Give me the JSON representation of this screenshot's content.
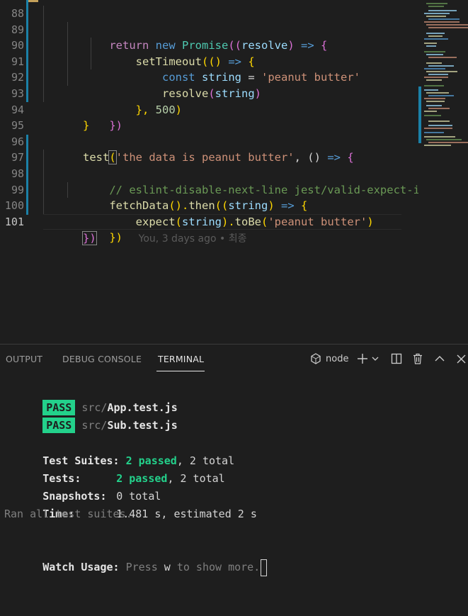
{
  "editor": {
    "line_numbers": [
      "88",
      "89",
      "90",
      "91",
      "92",
      "93",
      "94",
      "95",
      "96",
      "97",
      "98",
      "99",
      "100",
      "101"
    ],
    "lines": {
      "l88": {
        "kw": "return",
        "new": "new",
        "cls": "Promise",
        "p1": "((",
        "param": "resolve",
        "p2": ")",
        "arrow": " => ",
        "brace": "{"
      },
      "l89": {
        "fn": "setTimeout",
        "p1": "(()",
        "arrow": " => ",
        "brace": "{"
      },
      "l90": {
        "kw": "const",
        "var": "string",
        "eq": " = ",
        "str": "'peanut butter'"
      },
      "l91": {
        "fn": "resolve",
        "p1": "(",
        "var": "string",
        "p2": ")"
      },
      "l92": {
        "close": "}, ",
        "num": "500",
        "p": ")"
      },
      "l93": {
        "text": "})"
      },
      "l94": {
        "text": "}"
      },
      "l96": {
        "fn": "test",
        "p1": "(",
        "str": "'the data is peanut butter'",
        "mid": ", () ",
        "arrow": "=>",
        "brace": " {"
      },
      "l97": {
        "comment": "// eslint-disable-next-line jest/valid-expect-in-promise"
      },
      "l98": {
        "fn": "fetchData",
        "p1": "().",
        "fn2": "then",
        "p2": "((",
        "var": "string",
        "p3": ")",
        "arrow": " => ",
        "brace": "{"
      },
      "l99": {
        "fn": "expect",
        "p1": "(",
        "var": "string",
        "p2": ").",
        "fn2": "toBe",
        "p3": "(",
        "str": "'peanut butter'",
        "p4": ")"
      },
      "l100": {
        "text": "})"
      },
      "l101": {
        "text": "})",
        "blame": "You, 3 days ago • 최종"
      }
    }
  },
  "panel": {
    "tabs": [
      "OUTPUT",
      "DEBUG CONSOLE",
      "TERMINAL"
    ],
    "active_tab": "TERMINAL",
    "shell": "node",
    "terminal": {
      "pass_label": "PASS",
      "results": [
        {
          "dir": "src/",
          "file": "App.test.js"
        },
        {
          "dir": "src/",
          "file": "Sub.test.js"
        }
      ],
      "suites_label": "Test Suites:",
      "suites_passed": "2 passed",
      "suites_total": ", 2 total",
      "tests_label": "Tests:",
      "tests_passed": "2 passed",
      "tests_total": ", 2 total",
      "snapshots_label": "Snapshots:",
      "snapshots_value": "0 total",
      "time_label": "Time:",
      "time_value": "1.481 s, estimated 2 s",
      "ran_all": "Ran all test suites.",
      "watch_label": "Watch Usage:",
      "watch_press": " Press ",
      "watch_key": "w",
      "watch_rest": " to show more."
    }
  },
  "colors": {
    "background": "#1e1e1e",
    "pass_badge": "#23d18b",
    "modified_bar": "#1b81a8"
  }
}
